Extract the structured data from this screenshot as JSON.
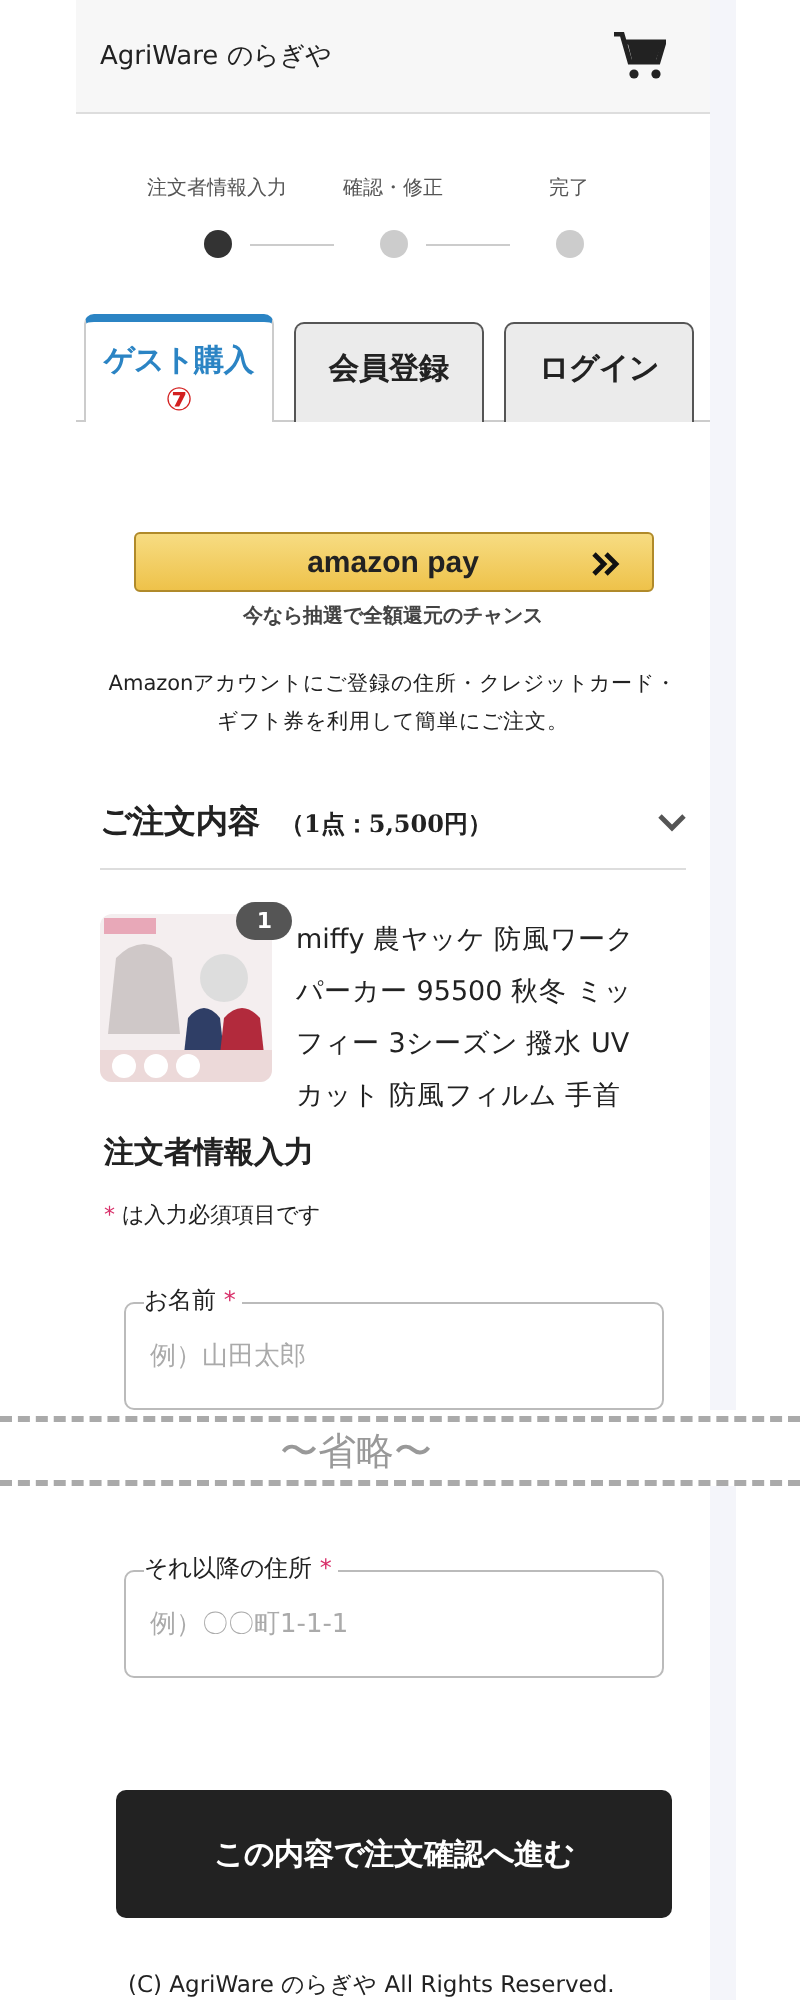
{
  "header": {
    "shop_name": "AgriWare のらぎや"
  },
  "steps": [
    {
      "label": "注文者情報入力",
      "selected": true
    },
    {
      "label": "確認・修正",
      "selected": false
    },
    {
      "label": "完了",
      "selected": false
    }
  ],
  "tabs": [
    {
      "label": "ゲスト購入",
      "selected": true,
      "annotation": "⑦"
    },
    {
      "label": "会員登録",
      "selected": false
    },
    {
      "label": "ログイン",
      "selected": false
    }
  ],
  "amazon_pay": {
    "label": "amazon pay",
    "note": "今なら抽選で全額還元のチャンス",
    "description": "Amazonアカウントにご登録の住所・クレジットカード・ギフト券を利用して簡単にご注文。"
  },
  "order_summary": {
    "title": "ご注文内容",
    "total": "（1点：5,500円）",
    "expanded": false,
    "items": [
      {
        "kind": "picture",
        "quantity": "1",
        "name": "miffy 農ヤッケ 防風ワークパーカー 95500 秋冬 ミッフィー 3シーズン 撥水 UVカット 防風フィルム 手首"
      }
    ]
  },
  "form": {
    "title": "注文者情報入力",
    "required_mark": "*",
    "required_note": "は入力必須項目です",
    "fields": [
      {
        "label": "お名前",
        "required": true,
        "required_mark": "*",
        "placeholder": "例）山田太郎"
      }
    ]
  },
  "omission": "〜省略〜",
  "form_continued": {
    "fields": [
      {
        "label": "それ以降の住所",
        "required": true,
        "required_mark": "*",
        "placeholder": "例）〇〇町1-1-1"
      }
    ]
  },
  "submit_button": "この内容で注文確認へ進む",
  "footer": "(C) AgriWare のらぎや All Rights Reserved."
}
